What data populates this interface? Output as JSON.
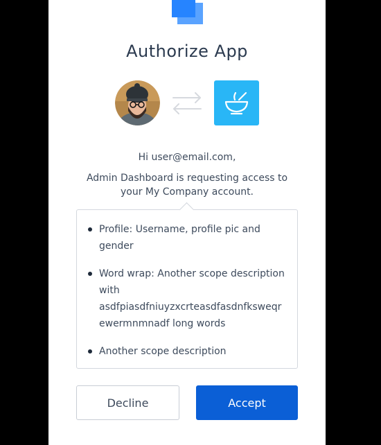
{
  "header": {
    "title": "Authorize App",
    "logo_icon": "stacked-squares-logo",
    "brand_color": "#2684ff"
  },
  "connection": {
    "user_avatar": "user-avatar-photo",
    "swap_icon": "swap-arrows-icon",
    "app_icon": "bowl-icon",
    "app_icon_color": "#29b6f6"
  },
  "message": {
    "greeting": "Hi user@email.com,",
    "request": "Admin Dashboard is requesting access to your My Company account."
  },
  "scopes": [
    "Profile: Username, profile pic and gender",
    "Word wrap: Another scope description with asdfpiasdfniuyzxcrteasdfasdnfksweqrewermnmnadf long words",
    "Another scope description"
  ],
  "actions": {
    "decline_label": "Decline",
    "accept_label": "Accept",
    "accept_color": "#0b5fd6"
  }
}
